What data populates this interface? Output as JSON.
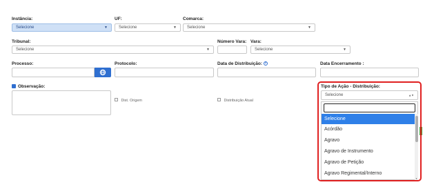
{
  "instancia": {
    "label": "Instância:",
    "value": "Selecione"
  },
  "uf": {
    "label": "UF:",
    "value": "Selecione"
  },
  "comarca": {
    "label": "Comarca:",
    "value": "Selecione"
  },
  "tribunal": {
    "label": "Tribunal:",
    "value": "Selecione"
  },
  "numero_vara": {
    "label": "Número Vara:",
    "value": ""
  },
  "vara": {
    "label": "Vara:",
    "value": "Selecione"
  },
  "processo": {
    "label": "Processo:",
    "value": ""
  },
  "protocolo": {
    "label": "Protocolo:",
    "value": ""
  },
  "data_distribuicao": {
    "label": "Data de Distribuição:",
    "help_icon": "help-circle-icon",
    "value": ""
  },
  "data_encerramento": {
    "label": "Data Encerramento :",
    "value": ""
  },
  "observacao": {
    "label": "Observação:",
    "checked": true,
    "value": ""
  },
  "dist_origem": {
    "label": "Dist. Origem"
  },
  "distribuicao_atual": {
    "label": "Distribuição Atual"
  },
  "tipo_acao": {
    "label": "Tipo de Ação - Distribuição:",
    "value": "Selecione",
    "search_value": "",
    "options": [
      "Selecione",
      "Acórdão",
      "Agravo",
      "Agravo de Instrumento",
      "Agravo de Petição",
      "Agravo Regimental/Interno"
    ],
    "highlighted": "Selecione"
  },
  "colors": {
    "accent": "#2f6fd0",
    "highlight_border": "#e02020",
    "selected_bg": "#cfe0f6"
  }
}
